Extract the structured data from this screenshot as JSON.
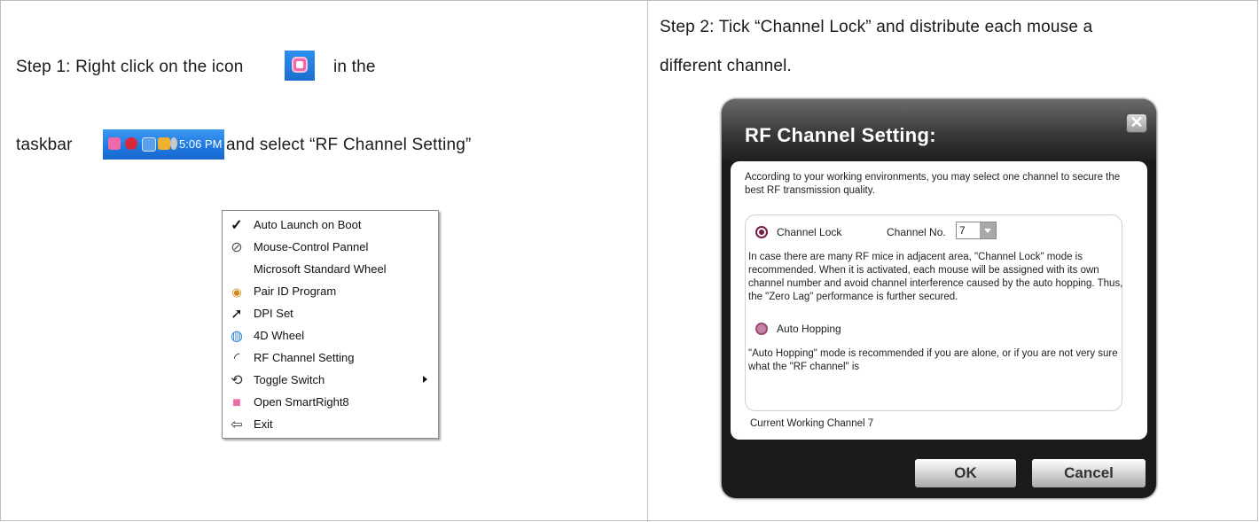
{
  "step1": {
    "line1_prefix": "Step 1:    Right click on the icon",
    "line1_suffix": "in the",
    "line2_prefix": "taskbar",
    "line2_suffix": "and select “RF Channel Setting”",
    "tray_clock": "5:06 PM"
  },
  "context_menu": {
    "items": [
      {
        "label": "Auto Launch on Boot",
        "icon": "checkmark-icon"
      },
      {
        "label": "Mouse-Control Pannel",
        "icon": "mouse-control-icon"
      },
      {
        "label": "Microsoft Standard Wheel",
        "icon": ""
      },
      {
        "label": "Pair ID Program",
        "icon": "pair-id-icon"
      },
      {
        "label": "DPI Set",
        "icon": "dpi-cursor-icon"
      },
      {
        "label": "4D Wheel",
        "icon": "wheel-icon"
      },
      {
        "label": "RF Channel Setting",
        "icon": "rf-signal-icon"
      },
      {
        "label": "Toggle Switch",
        "icon": "toggle-icon",
        "submenu": true
      },
      {
        "label": "Open SmartRight8",
        "icon": "smartright-icon"
      },
      {
        "label": "Exit",
        "icon": "exit-arrow-icon"
      }
    ]
  },
  "step2": {
    "line1": "Step 2:    Tick “Channel Lock” and distribute each mouse a",
    "line2": "different channel."
  },
  "dialog": {
    "title": "RF Channel Setting:",
    "close_glyph": "✕",
    "intro": "According to your working environments, you may select one channel to secure the best RF transmission quality.",
    "channel_lock_label": "Channel Lock",
    "channel_no_label": "Channel No.",
    "channel_no_value": "7",
    "channel_lock_desc": "In case there are many RF mice in adjacent area, \"Channel Lock\" mode is recommended. When it is activated, each mouse will be assigned with its own channel number and avoid channel interference caused by the auto hopping. Thus, the \"Zero Lag\" performance is further secured.",
    "auto_hopping_label": "Auto Hopping",
    "auto_hopping_desc": "\"Auto Hopping\" mode is recommended if you are alone, or if you are not very sure what the \"RF channel\" is",
    "current_channel": "Current Working Channel    7",
    "ok_label": "OK",
    "cancel_label": "Cancel"
  },
  "colors": {
    "taskbar_blue": "#1d78e0",
    "dialog_dark": "#1b1b1b",
    "radio_maroon": "#7a1a46"
  }
}
